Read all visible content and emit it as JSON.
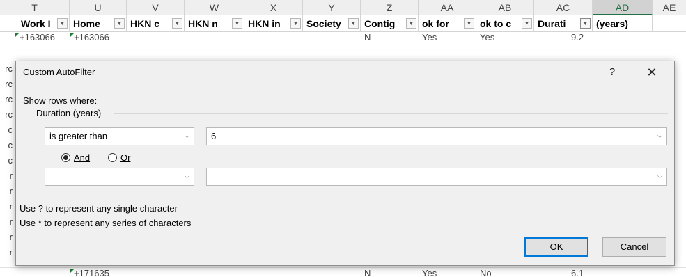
{
  "sheet": {
    "columns": [
      "T",
      "U",
      "V",
      "W",
      "X",
      "Y",
      "Z",
      "AA",
      "AB",
      "AC",
      "AD",
      "AE"
    ],
    "active_column": "AD",
    "headers": [
      "Work I",
      "Home",
      "HKN c",
      "HKN n",
      "HKN in",
      "Society",
      "Contig",
      "ok for",
      "ok to c",
      "Durati",
      "(years)"
    ],
    "first_row": {
      "work": "+163066",
      "home": "+163066",
      "contig": "N",
      "ok_for": "Yes",
      "ok_to": "Yes",
      "duration": "9.2"
    },
    "last_row": {
      "home": "+171635",
      "contig": "N",
      "ok_for": "Yes",
      "ok_to": "No",
      "duration": "6.1"
    },
    "row_fragments": [
      "rc",
      "rc",
      "rc",
      "rc",
      "c",
      "c",
      "c",
      "r",
      "r",
      "r",
      "r",
      "r",
      "r"
    ]
  },
  "dialog": {
    "title": "Custom AutoFilter",
    "help_label": "?",
    "close_label": "✕",
    "show_rows_label": "Show rows where:",
    "field_name": "Duration (years)",
    "condition1": {
      "operator": "is greater than",
      "value": "6"
    },
    "condition2": {
      "operator": "",
      "value": ""
    },
    "logic": {
      "and_label": "And",
      "or_label": "Or",
      "selected": "and"
    },
    "hint_single": "Use ? to represent any single character",
    "hint_series": "Use * to represent any series of characters",
    "ok_label": "OK",
    "cancel_label": "Cancel"
  },
  "colors": {
    "excel_green": "#217346",
    "dialog_bg": "#f0f0f0",
    "ok_border": "#0078d7"
  }
}
